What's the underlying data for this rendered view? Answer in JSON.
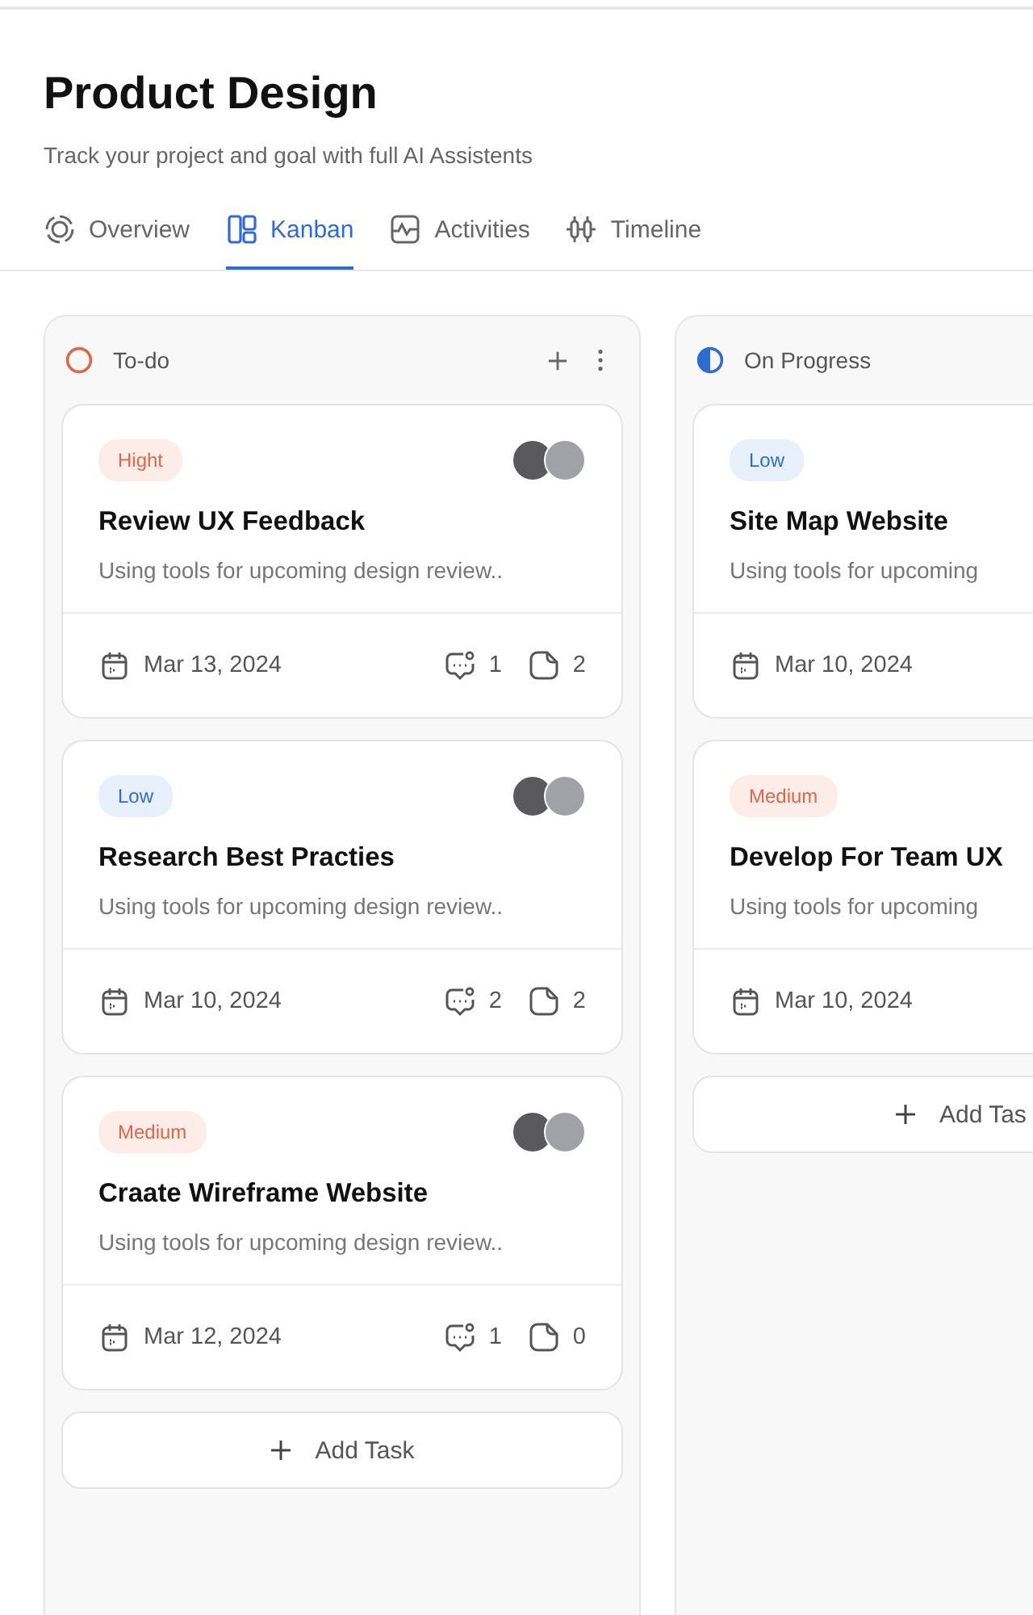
{
  "header": {
    "title": "Product Design",
    "subtitle": "Track your project and goal with full AI Assistents"
  },
  "tabs": [
    {
      "label": "Overview",
      "selected": false
    },
    {
      "label": "Kanban",
      "selected": true
    },
    {
      "label": "Activities",
      "selected": false
    },
    {
      "label": "Timeline",
      "selected": false
    }
  ],
  "columns": [
    {
      "title": "To-do",
      "kind": "todo",
      "actions": true,
      "add_label": "Add Task",
      "cards": [
        {
          "priority": "Hight",
          "kind": "high",
          "avatars": true,
          "title": "Review UX Feedback",
          "description": "Using tools for upcoming design review..",
          "date": "Mar 13, 2024",
          "comments": "1",
          "files": "2"
        },
        {
          "priority": "Low",
          "kind": "low",
          "avatars": true,
          "title": "Research Best Practies",
          "description": "Using tools for upcoming design review..",
          "date": "Mar 10, 2024",
          "comments": "2",
          "files": "2"
        },
        {
          "priority": "Medium",
          "kind": "medium",
          "avatars": true,
          "title": "Craate Wireframe Website",
          "description": "Using tools for upcoming design review..",
          "date": "Mar 12, 2024",
          "comments": "1",
          "files": "0"
        }
      ]
    },
    {
      "title": "On Progress",
      "kind": "progress",
      "actions": false,
      "add_label": "Add Tas",
      "cards": [
        {
          "priority": "Low",
          "kind": "low",
          "avatars": false,
          "title": "Site Map Website",
          "description": "Using tools for upcoming",
          "date": "Mar 10, 2024"
        },
        {
          "priority": "Medium",
          "kind": "medium",
          "avatars": false,
          "title": "Develop For Team UX",
          "description": "Using tools for upcoming",
          "date": "Mar 10, 2024"
        }
      ]
    }
  ]
}
